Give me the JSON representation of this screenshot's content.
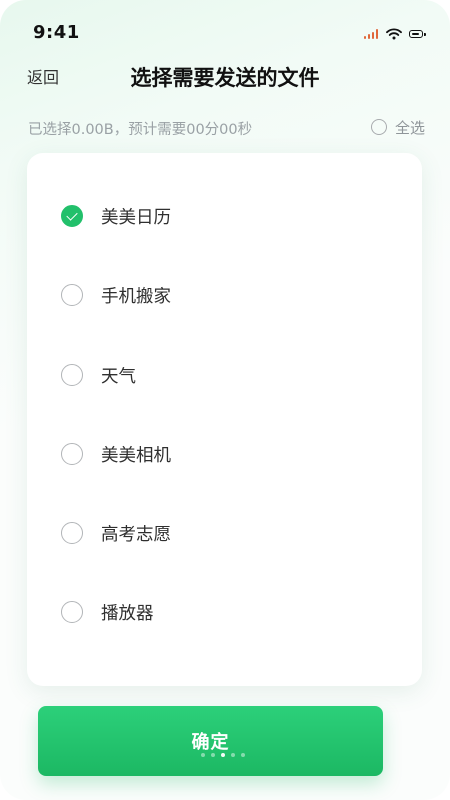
{
  "status_bar": {
    "time": "9:41"
  },
  "header": {
    "back_label": "返回",
    "title": "选择需要发送的文件"
  },
  "summary": {
    "text": "已选择0.00B，预计需要00分00秒",
    "select_all_label": "全选",
    "select_all_checked": false
  },
  "files": [
    {
      "name": "美美日历",
      "checked": true
    },
    {
      "name": "手机搬家",
      "checked": false
    },
    {
      "name": "天气",
      "checked": false
    },
    {
      "name": "美美相机",
      "checked": false
    },
    {
      "name": "高考志愿",
      "checked": false
    },
    {
      "name": "播放器",
      "checked": false
    }
  ],
  "confirm": {
    "label": "确定"
  },
  "pager": {
    "count": 5,
    "active_index": 2
  },
  "colors": {
    "accent": "#22c06b",
    "signal": "#e0673a"
  }
}
